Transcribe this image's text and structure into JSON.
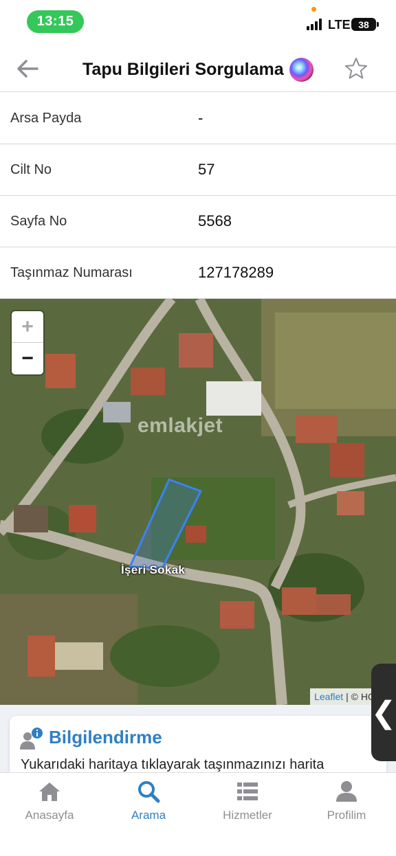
{
  "status_bar": {
    "time": "13:15",
    "network": "LTE",
    "battery": "38"
  },
  "header": {
    "title": "Tapu Bilgileri Sorgulama",
    "back_icon": "arrow-left-icon",
    "favorite_icon": "star-icon"
  },
  "rows": [
    {
      "label": "Arsa Payda",
      "value": "-"
    },
    {
      "label": "Cilt No",
      "value": "57"
    },
    {
      "label": "Sayfa No",
      "value": "5568"
    },
    {
      "label": "Taşınmaz Numarası",
      "value": "127178289"
    }
  ],
  "map": {
    "zoom_in": "+",
    "zoom_out": "−",
    "street_label": "İşeri Sokak",
    "watermark": "emlakjet",
    "attribution_link": "Leaflet",
    "attribution_text": "| © HGM A",
    "parcel_color": "#3b82f6"
  },
  "side_tab": {
    "glyph": "❮"
  },
  "info_card": {
    "title": "Bilgilendirme",
    "text": "Yukarıdaki haritaya tıklayarak taşınmazınızı harita",
    "accent": "#2f7fc4"
  },
  "tabbar": {
    "items": [
      {
        "label": "Anasayfa",
        "icon": "home-icon",
        "active": false
      },
      {
        "label": "Arama",
        "icon": "search-icon",
        "active": true
      },
      {
        "label": "Hizmetler",
        "icon": "list-icon",
        "active": false
      },
      {
        "label": "Profilim",
        "icon": "profile-icon",
        "active": false
      }
    ]
  }
}
